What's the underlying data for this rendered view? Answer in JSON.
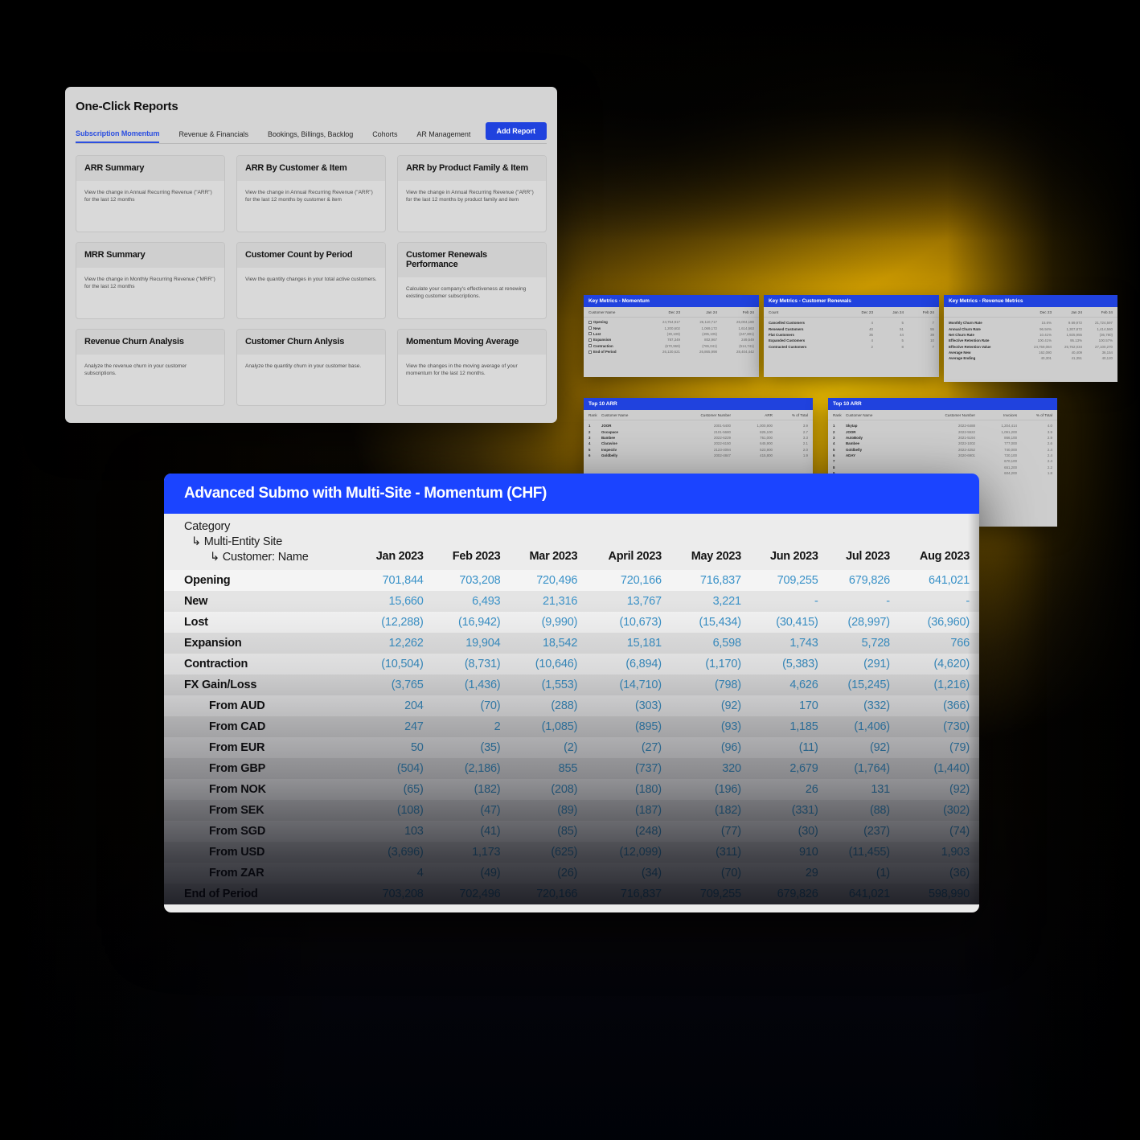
{
  "reports_panel": {
    "title": "One-Click Reports",
    "tabs": [
      {
        "label": "Subscription Momentum",
        "active": true
      },
      {
        "label": "Revenue & Financials",
        "active": false
      },
      {
        "label": "Bookings, Billings, Backlog",
        "active": false
      },
      {
        "label": "Cohorts",
        "active": false
      },
      {
        "label": "AR Management",
        "active": false
      }
    ],
    "add_report_label": "Add Report",
    "cards": [
      {
        "title": "ARR Summary",
        "desc": "View the change in Annual Recurring Revenue (\"ARR\") for the last 12 months"
      },
      {
        "title": "ARR By Customer & Item",
        "desc": "View the change in Annual Recurring Revenue (\"ARR\") for the last 12 months by customer & item"
      },
      {
        "title": "ARR by Product Family & Item",
        "desc": "View the change in Annual Recurring Revenue (\"ARR\") for the last 12 months by product family and item"
      },
      {
        "title": "MRR Summary",
        "desc": "View the change in Monthly Recurring Revenue (\"MRR\") for the last 12 months"
      },
      {
        "title": "Customer Count by Period",
        "desc": "View the quantity changes in your total active customers."
      },
      {
        "title": "Customer Renewals Performance",
        "desc": "Calculate your company's effectiveness at renewing existing customer subscriptions."
      },
      {
        "title": "Revenue Churn Analysis",
        "desc": "Analyze the revenue churn in your customer subscriptions."
      },
      {
        "title": "Customer Churn Anlysis",
        "desc": "Analyze the quantity churn in your customer base."
      },
      {
        "title": "Momentum Moving Average",
        "desc": "View the changes in the moving average of your momentum for the last 12 months."
      }
    ]
  },
  "key_metrics_momentum": {
    "title": "Key Metrics - Momentum",
    "columns": [
      "Customer Name",
      "Dec 23",
      "Jan 24",
      "Feb 24"
    ],
    "rows": [
      {
        "label": "Opening",
        "values": [
          "24,754,917",
          "26,110,717",
          "26,004,180"
        ]
      },
      {
        "label": "New",
        "values": [
          "1,200,602",
          "1,069,172",
          "1,614,563"
        ]
      },
      {
        "label": "Lost",
        "values": [
          "(30,109)",
          "(495,105)",
          "(247,801)"
        ]
      },
      {
        "label": "Expansion",
        "values": [
          "787,349",
          "802,967",
          "249,549"
        ]
      },
      {
        "label": "Contraction",
        "values": [
          "(670,969)",
          "(765,041)",
          "(514,741)"
        ]
      },
      {
        "label": "End of Period",
        "values": [
          "26,130,621",
          "26,865,998",
          "28,404,442"
        ]
      }
    ]
  },
  "key_metrics_renewals": {
    "title": "Key Metrics - Customer Renewals",
    "columns": [
      "Count",
      "Dec 23",
      "Jan 24",
      "Feb 24"
    ],
    "rows": [
      {
        "label": "Cancelled Customers",
        "values": [
          "4",
          "5",
          "7"
        ]
      },
      {
        "label": "Renewed Customers",
        "values": [
          "40",
          "51",
          "55"
        ]
      },
      {
        "label": "Flat Customers",
        "values": [
          "35",
          "44",
          "39"
        ]
      },
      {
        "label": "Expanded Customers",
        "values": [
          "4",
          "5",
          "10"
        ]
      },
      {
        "label": "Contracted Customers",
        "values": [
          "2",
          "8",
          "7"
        ]
      }
    ]
  },
  "key_metrics_revenue": {
    "title": "Key Metrics - Revenue Metrics",
    "columns": [
      "",
      "Dec 23",
      "Jan 24",
      "Feb 24"
    ],
    "rows": [
      {
        "label": "Monthly Churn Rate",
        "values": [
          "15.6%",
          "9.69,972",
          "21,724,597"
        ]
      },
      {
        "label": "Annual Churn Rate",
        "values": [
          "96.94%",
          "1,307,872",
          "1,414,560"
        ]
      },
      {
        "label": "Net Churn Rate",
        "values": [
          "10.41%",
          "1,925,955",
          "(36,780)"
        ]
      },
      {
        "label": "Effective Retention Rate",
        "values": [
          "100.41%",
          "95.13%",
          "100.57%"
        ]
      },
      {
        "label": "Effective Retention Value",
        "values": [
          "24,759,084",
          "25,762,034",
          "27,100,270"
        ]
      },
      {
        "label": "Average New",
        "values": [
          "162,080",
          "40,409",
          "36,154"
        ]
      },
      {
        "label": "Average Ending",
        "values": [
          "40,301",
          "41,351",
          "40,120"
        ]
      }
    ]
  },
  "top10_arr": {
    "title": "Top 10 ARR",
    "columns": [
      "Rank",
      "Customer Name",
      "Customer Number",
      "ARR",
      "% of Total"
    ],
    "rows": [
      {
        "rank": "1",
        "name": "JOOR",
        "number": "2001-5400",
        "value": "1,000,900",
        "pct": "3.9"
      },
      {
        "rank": "2",
        "name": "Occupace",
        "number": "2101-5680",
        "value": "825,100",
        "pct": "2.7"
      },
      {
        "rank": "3",
        "name": "Bambee",
        "number": "2022-6229",
        "value": "761,000",
        "pct": "3.3"
      },
      {
        "rank": "4",
        "name": "Claravine",
        "number": "2022-6150",
        "value": "645,900",
        "pct": "2.1"
      },
      {
        "rank": "5",
        "name": "Inspectiv",
        "number": "2123-4094",
        "value": "523,900",
        "pct": "2.0"
      },
      {
        "rank": "6",
        "name": "Goldbelly",
        "number": "2002-4847",
        "value": "415,800",
        "pct": "1.9"
      }
    ]
  },
  "top10_invoices": {
    "title": "Top 10 ARR",
    "columns": [
      "Rank",
      "Customer Name",
      "Customer Number",
      "Invoices",
      "% of Total"
    ],
    "rows": [
      {
        "rank": "1",
        "name": "Skytap",
        "number": "2022-6488",
        "value": "1,204,414",
        "pct": "4.0"
      },
      {
        "rank": "2",
        "name": "JOOR",
        "number": "2022-5522",
        "value": "1,091,200",
        "pct": "3.9"
      },
      {
        "rank": "3",
        "name": "AutoBody",
        "number": "2021-5194",
        "value": "866,100",
        "pct": "2.9"
      },
      {
        "rank": "4",
        "name": "Bambee",
        "number": "2022-1002",
        "value": "777,000",
        "pct": "2.6"
      },
      {
        "rank": "5",
        "name": "Goldbelly",
        "number": "2022-4252",
        "value": "740,000",
        "pct": "2.4"
      },
      {
        "rank": "6",
        "name": "ADAY",
        "number": "2020-6901",
        "value": "720,100",
        "pct": "2.4"
      },
      {
        "rank": "7",
        "name": "",
        "number": "",
        "value": "670,100",
        "pct": "2.4"
      },
      {
        "rank": "8",
        "name": "",
        "number": "",
        "value": "651,200",
        "pct": "2.2"
      },
      {
        "rank": "9",
        "name": "",
        "number": "",
        "value": "604,200",
        "pct": "1.8"
      }
    ]
  },
  "momentum_report": {
    "title": "Advanced Submo with Multi-Site - Momentum (CHF)",
    "header_hierarchy": {
      "level1": "Category",
      "level2": "Multi-Entity Site",
      "level3": "Customer: Name"
    },
    "months": [
      "Jan 2023",
      "Feb 2023",
      "Mar 2023",
      "April 2023",
      "May 2023",
      "Jun 2023",
      "Jul 2023",
      "Aug 2023"
    ],
    "rows": [
      {
        "label": "Opening",
        "sub": false,
        "values": [
          "701,844",
          "703,208",
          "720,496",
          "720,166",
          "716,837",
          "709,255",
          "679,826",
          "641,021"
        ]
      },
      {
        "label": "New",
        "sub": false,
        "values": [
          "15,660",
          "6,493",
          "21,316",
          "13,767",
          "3,221",
          "-",
          "-",
          "-"
        ]
      },
      {
        "label": "Lost",
        "sub": false,
        "values": [
          "(12,288)",
          "(16,942)",
          "(9,990)",
          "(10,673)",
          "(15,434)",
          "(30,415)",
          "(28,997)",
          "(36,960)"
        ]
      },
      {
        "label": "Expansion",
        "sub": false,
        "values": [
          "12,262",
          "19,904",
          "18,542",
          "15,181",
          "6,598",
          "1,743",
          "5,728",
          "766"
        ]
      },
      {
        "label": "Contraction",
        "sub": false,
        "values": [
          "(10,504)",
          "(8,731)",
          "(10,646)",
          "(6,894)",
          "(1,170)",
          "(5,383)",
          "(291)",
          "(4,620)"
        ]
      },
      {
        "label": "FX Gain/Loss",
        "sub": false,
        "values": [
          "(3,765",
          "(1,436)",
          "(1,553)",
          "(14,710)",
          "(798)",
          "4,626",
          "(15,245)",
          "(1,216)"
        ]
      },
      {
        "label": "From AUD",
        "sub": true,
        "values": [
          "204",
          "(70)",
          "(288)",
          "(303)",
          "(92)",
          "170",
          "(332)",
          "(366)"
        ]
      },
      {
        "label": "From CAD",
        "sub": true,
        "values": [
          "247",
          "2",
          "(1,085)",
          "(895)",
          "(93)",
          "1,185",
          "(1,406)",
          "(730)"
        ]
      },
      {
        "label": "From EUR",
        "sub": true,
        "values": [
          "50",
          "(35)",
          "(2)",
          "(27)",
          "(96)",
          "(11)",
          "(92)",
          "(79)"
        ]
      },
      {
        "label": "From GBP",
        "sub": true,
        "values": [
          "(504)",
          "(2,186)",
          "855",
          "(737)",
          "320",
          "2,679",
          "(1,764)",
          "(1,440)"
        ]
      },
      {
        "label": "From NOK",
        "sub": true,
        "values": [
          "(65)",
          "(182)",
          "(208)",
          "(180)",
          "(196)",
          "26",
          "131",
          "(92)"
        ]
      },
      {
        "label": "From SEK",
        "sub": true,
        "values": [
          "(108)",
          "(47)",
          "(89)",
          "(187)",
          "(182)",
          "(331)",
          "(88)",
          "(302)"
        ]
      },
      {
        "label": "From SGD",
        "sub": true,
        "values": [
          "103",
          "(41)",
          "(85)",
          "(248)",
          "(77)",
          "(30)",
          "(237)",
          "(74)"
        ]
      },
      {
        "label": "From USD",
        "sub": true,
        "values": [
          "(3,696)",
          "1,173",
          "(625)",
          "(12,099)",
          "(311)",
          "910",
          "(11,455)",
          "1,903"
        ]
      },
      {
        "label": "From ZAR",
        "sub": true,
        "values": [
          "4",
          "(49)",
          "(26)",
          "(34)",
          "(70)",
          "29",
          "(1)",
          "(36)"
        ]
      },
      {
        "label": "End of Period",
        "sub": false,
        "values": [
          "703,208",
          "702,496",
          "720,166",
          "716,837",
          "709,255",
          "679,826",
          "641,021",
          "598,990"
        ]
      }
    ]
  },
  "colors": {
    "brand_blue": "#2042de",
    "title_blue": "#1b44ff",
    "value_blue": "#3a92c8",
    "panel_gray": "#d4d4d4",
    "accent_yellow": "#f2c200"
  }
}
